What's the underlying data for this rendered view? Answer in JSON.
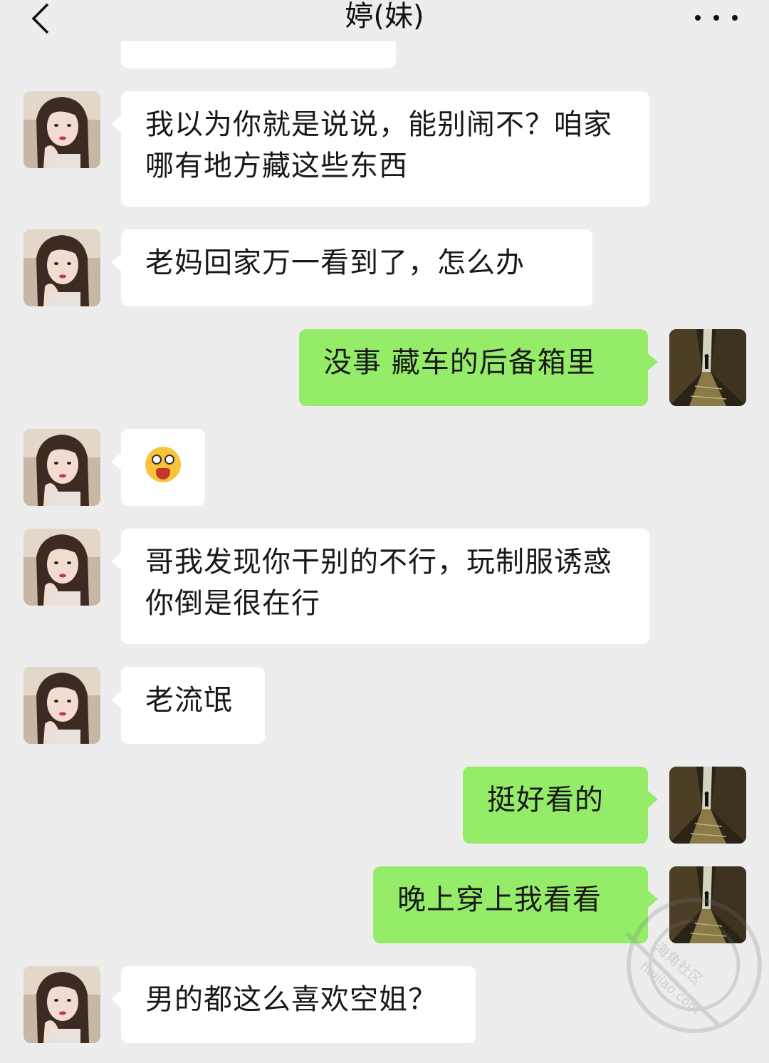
{
  "header": {
    "title": "婷(妹)",
    "back_icon": "chevron-left-icon",
    "more_icon": "more-dots-icon"
  },
  "messages": [
    {
      "side": "in",
      "text": "我以为你就是说说，能别闹不？咱家哪有地方藏这些东西"
    },
    {
      "side": "in",
      "text": "老妈回家万一看到了，怎么办"
    },
    {
      "side": "out",
      "text": "没事 藏车的后备箱里"
    },
    {
      "side": "in",
      "emoji": "starry-eyed-tongue-emoji"
    },
    {
      "side": "in",
      "text": "哥我发现你干别的不行，玩制服诱惑你倒是很在行"
    },
    {
      "side": "in",
      "text": "老流氓"
    },
    {
      "side": "out",
      "text": "挺好看的"
    },
    {
      "side": "out",
      "text": "晚上穿上我看看"
    },
    {
      "side": "in",
      "text": "男的都这么喜欢空姐？"
    }
  ],
  "watermark": {
    "text1": "海角社区",
    "text2": "haijiao.com"
  },
  "colors": {
    "background": "#ededed",
    "incoming_bubble": "#ffffff",
    "outgoing_bubble": "#95ec69"
  }
}
